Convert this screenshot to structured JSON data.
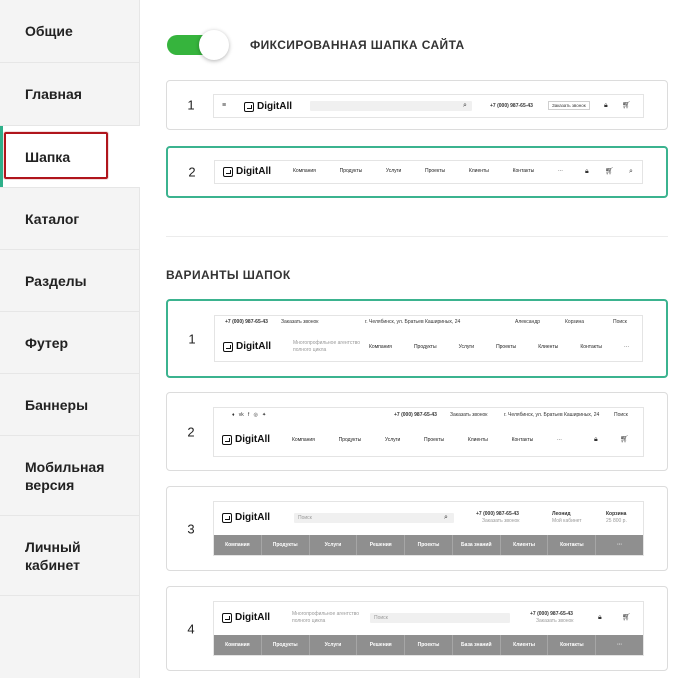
{
  "sidebar": {
    "items": [
      {
        "label": "Общие"
      },
      {
        "label": "Главная"
      },
      {
        "label": "Шапка"
      },
      {
        "label": "Каталог"
      },
      {
        "label": "Разделы"
      },
      {
        "label": "Футер"
      },
      {
        "label": "Баннеры"
      },
      {
        "label": "Мобильная версия"
      },
      {
        "label": "Личный кабинет"
      }
    ]
  },
  "fixed_header": {
    "label": "ФИКСИРОВАННАЯ ШАПКА САЙТА",
    "enabled": true,
    "toggle_color": "#36b43d"
  },
  "accent_color": "#3bb38f",
  "fixed_options": [
    {
      "number": "1"
    },
    {
      "number": "2"
    }
  ],
  "variants_title": "ВАРИАНТЫ ШАПОК",
  "variants": [
    {
      "number": "1"
    },
    {
      "number": "2"
    },
    {
      "number": "3"
    },
    {
      "number": "4"
    }
  ],
  "preview": {
    "logo": "DigitAll",
    "phone": "+7 (000) 987-65-43",
    "callback": "Заказать звонок",
    "address": "г. Челябинск, ул. Братьев Кашириных, 24",
    "user": "Александр",
    "cart": "Корзина",
    "cart_count": "0",
    "search": "Поиск",
    "search_placeholder": "Поиск",
    "tagline_1": "Многопрофильное агентство",
    "tagline_2": "полного цикла",
    "user_name": "Леонид",
    "user_sub": "Мой кабинет",
    "cart_label": "Корзина",
    "cart_sum": "25 800 р.",
    "more": "···",
    "nav_short": [
      "Компания",
      "Продукты",
      "Услуги",
      "Проекты",
      "Клиенты",
      "Контакты"
    ],
    "nav_long": [
      "Компания",
      "Продукты",
      "Услуги",
      "Решения",
      "Проекты",
      "База знаний",
      "Клиенты",
      "Контакты"
    ]
  }
}
